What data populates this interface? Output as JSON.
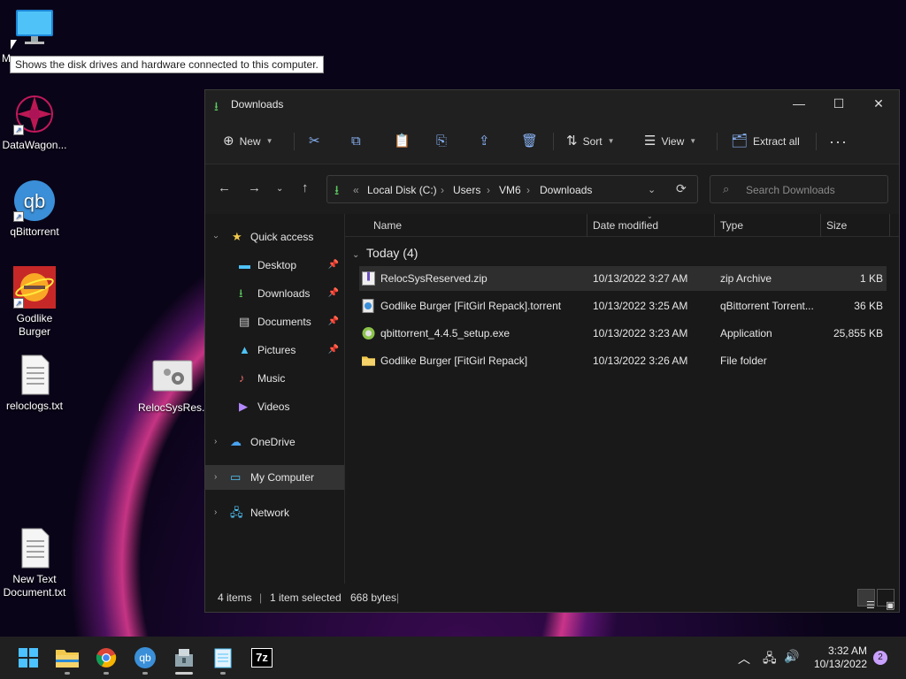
{
  "desktop": {
    "icons": [
      {
        "label": "My Computer",
        "icon": "monitor-icon"
      },
      {
        "label": "DataWagon...",
        "icon": "datawagon-icon"
      },
      {
        "label": "qBittorrent",
        "icon": "qbittorrent-icon"
      },
      {
        "label": "Godlike Burger",
        "icon": "godlike-burger-icon"
      },
      {
        "label": "reloclogs.txt",
        "icon": "text-file-icon"
      },
      {
        "label": "RelocSysRes...",
        "icon": "settings-file-icon"
      },
      {
        "label": "New Text Document.txt",
        "icon": "text-file-icon"
      }
    ],
    "partial_label": "M",
    "tooltip": "Shows the disk drives and hardware connected to this computer."
  },
  "window": {
    "title": "Downloads",
    "controls": [
      "minimize",
      "maximize",
      "close"
    ],
    "toolbar": {
      "new_label": "New",
      "sort_label": "Sort",
      "view_label": "View",
      "extract_label": "Extract all",
      "icons": [
        "cut-icon",
        "copy-icon",
        "paste-icon",
        "rename-icon",
        "share-icon",
        "delete-icon",
        "more-icon"
      ]
    },
    "address": {
      "crumbs": [
        "Local Disk (C:)",
        "Users",
        "VM6",
        "Downloads"
      ],
      "overflow": "«"
    },
    "search": {
      "placeholder": "Search Downloads"
    },
    "sidebar": {
      "quick_access": "Quick access",
      "items": [
        {
          "label": "Desktop",
          "pinned": true
        },
        {
          "label": "Downloads",
          "pinned": true
        },
        {
          "label": "Documents",
          "pinned": true
        },
        {
          "label": "Pictures",
          "pinned": true
        },
        {
          "label": "Music",
          "pinned": false
        },
        {
          "label": "Videos",
          "pinned": false
        }
      ],
      "onedrive": "OneDrive",
      "my_computer": "My Computer",
      "network": "Network"
    },
    "columns": {
      "name": "Name",
      "date": "Date modified",
      "type": "Type",
      "size": "Size"
    },
    "group": "Today (4)",
    "files": [
      {
        "name": "RelocSysReserved.zip",
        "date": "10/13/2022 3:27 AM",
        "type": "zip Archive",
        "size": "1 KB",
        "selected": true
      },
      {
        "name": "Godlike Burger [FitGirl Repack].torrent",
        "date": "10/13/2022 3:25 AM",
        "type": "qBittorrent Torrent...",
        "size": "36 KB",
        "selected": false
      },
      {
        "name": "qbittorrent_4.4.5_setup.exe",
        "date": "10/13/2022 3:23 AM",
        "type": "Application",
        "size": "25,855 KB",
        "selected": false
      },
      {
        "name": "Godlike Burger [FitGirl Repack]",
        "date": "10/13/2022 3:26 AM",
        "type": "File folder",
        "size": "",
        "selected": false
      }
    ],
    "status": {
      "items": "4 items",
      "selected": "1 item selected",
      "size": "668 bytes"
    }
  },
  "taskbar": {
    "apps": [
      "start-icon",
      "file-explorer-icon",
      "chrome-icon",
      "qbittorrent-icon",
      "installer-icon",
      "notepad-icon",
      "7zip-icon"
    ],
    "app_text_7z": "7z",
    "app_text_qb": "qb",
    "time": "3:32 AM",
    "date": "10/13/2022",
    "notification_count": "2"
  },
  "colors": {
    "accent": "#4cc2ff",
    "window_bg": "#191919",
    "selected_row": "#2e2e2e",
    "folder": "#f2c94c"
  }
}
